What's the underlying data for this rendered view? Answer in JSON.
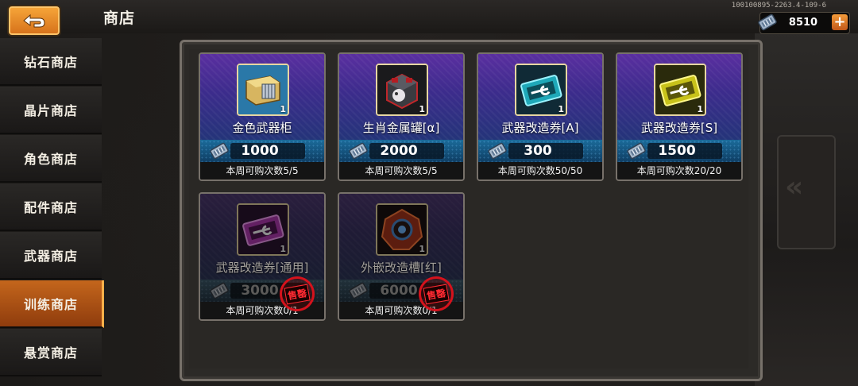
{
  "header": {
    "title": "商店",
    "version": "100100895-2263.4-109-6",
    "currency_value": "8510"
  },
  "sidebar": {
    "items": [
      {
        "label": "钻石商店",
        "active": false
      },
      {
        "label": "晶片商店",
        "active": false
      },
      {
        "label": "角色商店",
        "active": false
      },
      {
        "label": "配件商店",
        "active": false
      },
      {
        "label": "武器商店",
        "active": false
      },
      {
        "label": "训练商店",
        "active": true
      },
      {
        "label": "悬赏商店",
        "active": false
      }
    ]
  },
  "shop": {
    "items": [
      {
        "name": "金色武器柜",
        "price": "1000",
        "qty": "1",
        "limit": "本周可购次数5/5",
        "icon": "gold-weapon-cabinet-icon",
        "sold_out": false
      },
      {
        "name": "生肖金属罐[α]",
        "price": "2000",
        "qty": "1",
        "limit": "本周可购次数5/5",
        "icon": "zodiac-metal-canister-icon",
        "sold_out": false
      },
      {
        "name": "武器改造券[A]",
        "price": "300",
        "qty": "1",
        "limit": "本周可购次数50/50",
        "icon": "wrench-ticket-cyan-icon",
        "sold_out": false
      },
      {
        "name": "武器改造券[S]",
        "price": "1500",
        "qty": "1",
        "limit": "本周可购次数20/20",
        "icon": "wrench-ticket-gold-icon",
        "sold_out": false
      },
      {
        "name": "武器改造券[通用]",
        "price": "3000",
        "qty": "1",
        "limit": "本周可购次数0/1",
        "icon": "wrench-ticket-purple-icon",
        "sold_out": true,
        "stamp": "售罄"
      },
      {
        "name": "外嵌改造槽[红]",
        "price": "6000",
        "qty": "1",
        "limit": "本周可购次数0/1",
        "icon": "red-mod-slot-icon",
        "sold_out": true,
        "stamp": "售罄"
      }
    ]
  },
  "colors": {
    "accent_orange": "#e3841f",
    "card_purple": "#5a2fa0",
    "price_bar_blue": "#1b6b9a",
    "sold_stamp_red": "#d5121c"
  }
}
